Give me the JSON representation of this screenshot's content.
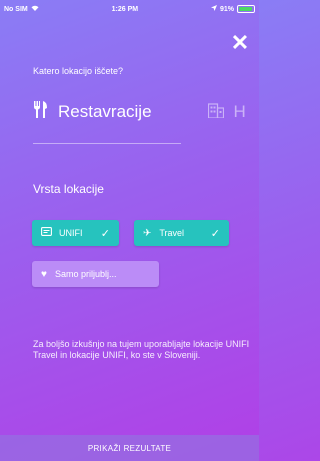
{
  "status_bar": {
    "carrier": "No SIM",
    "wifi_icon": "wifi-icon",
    "time": "1:26 PM",
    "location_icon": "location-arrow-icon",
    "battery": "91%",
    "battery_fill": 0.91,
    "battery_color": "#4cd964"
  },
  "header": {
    "close_icon": "close-icon",
    "question": "Katero lokacijo iščete?"
  },
  "categories": {
    "active": {
      "icon": "fork-knife-icon",
      "label": "Restavracije"
    },
    "next": {
      "icon": "building-icon",
      "label": "H"
    }
  },
  "location_type": {
    "title": "Vrsta lokacije",
    "chips": [
      {
        "icon": "card-icon",
        "label": "UNIFI",
        "selected": true,
        "color": "#26c3be"
      },
      {
        "icon": "plane-icon",
        "label": "Travel",
        "selected": true,
        "color": "#26c3be"
      },
      {
        "icon": "heart-icon",
        "label": "Samo priljublj...",
        "selected": false,
        "color": "#bb8cf7"
      }
    ]
  },
  "info_text": "Za boljšo izkušnjo na tujem uporabljajte lokacije UNIFI Travel in lokacije UNIFI, ko ste v Sloveniji.",
  "footer": {
    "show_results": "PRIKAŽI REZULTATE"
  }
}
